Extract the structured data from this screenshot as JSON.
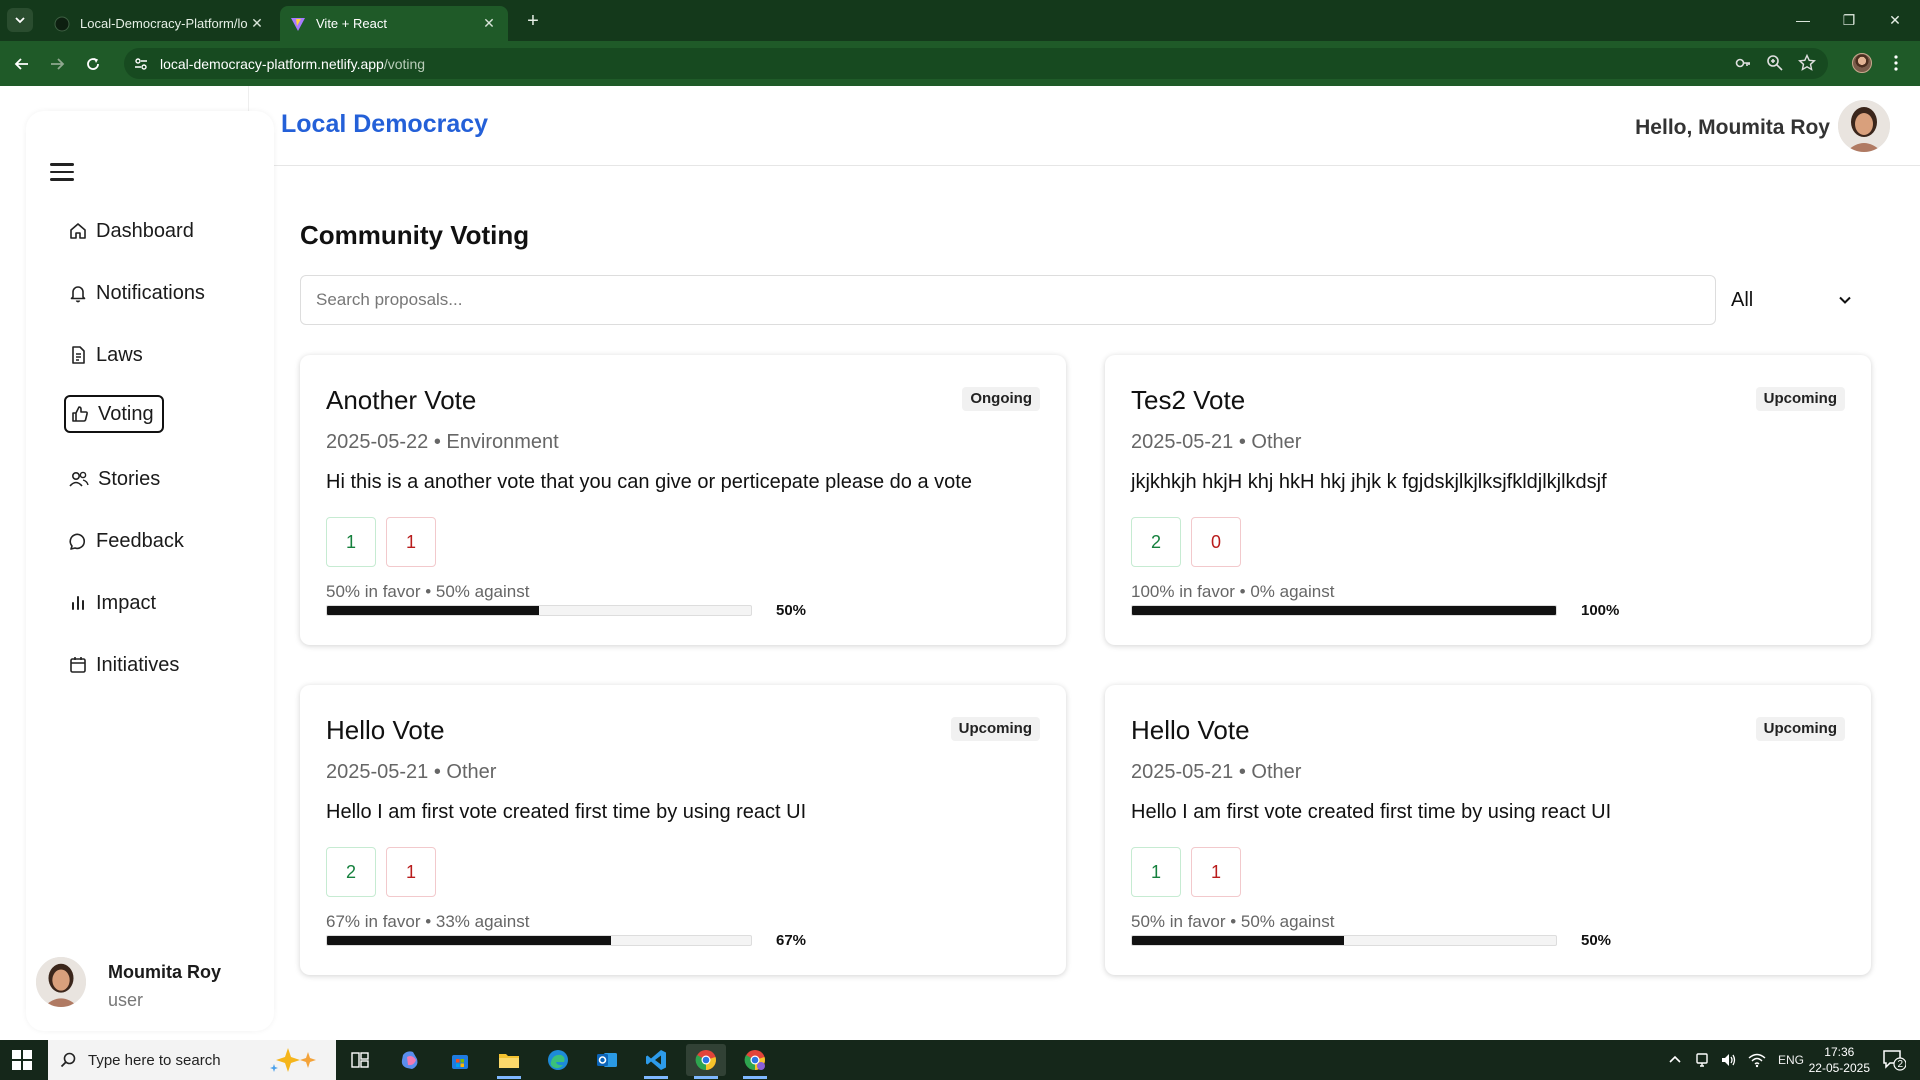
{
  "browser": {
    "tabs": [
      {
        "title": "Local-Democracy-Platform/loca",
        "active": false
      },
      {
        "title": "Vite + React",
        "active": true
      }
    ],
    "url_host": "local-democracy-platform.netlify.app",
    "url_path": "/voting"
  },
  "header": {
    "brand": "Local Democracy",
    "greeting": "Hello, Moumita Roy"
  },
  "sidebar": {
    "items": [
      {
        "label": "Dashboard",
        "icon": "home-icon"
      },
      {
        "label": "Notifications",
        "icon": "bell-icon"
      },
      {
        "label": "Laws",
        "icon": "document-icon"
      },
      {
        "label": "Voting",
        "icon": "thumbs-up-icon",
        "active": true
      },
      {
        "label": "Stories",
        "icon": "users-icon"
      },
      {
        "label": "Feedback",
        "icon": "chat-bubble-icon"
      },
      {
        "label": "Impact",
        "icon": "bar-chart-icon"
      },
      {
        "label": "Initiatives",
        "icon": "calendar-icon"
      }
    ],
    "profile": {
      "name": "Moumita Roy",
      "role": "user"
    }
  },
  "main": {
    "title": "Community Voting",
    "search_placeholder": "Search proposals...",
    "filter_value": "All",
    "cards": [
      {
        "title": "Another Vote",
        "status": "Ongoing",
        "meta": "2025-05-22 • Environment",
        "description": "Hi this is a another vote that you can give or perticepate please do a vote",
        "yes": "1",
        "no": "1",
        "ratio_text": "50% in favor • 50% against",
        "percent_label": "50%",
        "percent": 50
      },
      {
        "title": "Tes2 Vote",
        "status": "Upcoming",
        "meta": "2025-05-21 • Other",
        "description": "jkjkhkjh hkjH khj hkH hkj jhjk k fgjdskjlkjlksjfkldjlkjlkdsjf",
        "yes": "2",
        "no": "0",
        "ratio_text": "100% in favor • 0% against",
        "percent_label": "100%",
        "percent": 100
      },
      {
        "title": "Hello Vote",
        "status": "Upcoming",
        "meta": "2025-05-21 • Other",
        "description": "Hello I am first vote created first time by using react UI",
        "yes": "2",
        "no": "1",
        "ratio_text": "67% in favor • 33% against",
        "percent_label": "67%",
        "percent": 67
      },
      {
        "title": "Hello Vote",
        "status": "Upcoming",
        "meta": "2025-05-21 • Other",
        "description": "Hello I am first vote created first time by using react UI",
        "yes": "1",
        "no": "1",
        "ratio_text": "50% in favor • 50% against",
        "percent_label": "50%",
        "percent": 50
      }
    ]
  },
  "taskbar": {
    "search_placeholder": "Type here to search",
    "language": "ENG",
    "time": "17:36",
    "date": "22-05-2025",
    "notification_count": "2"
  },
  "colors": {
    "brand": "#2460d8",
    "browser_frame": "#14391b",
    "browser_toolbar": "#1f5a28",
    "vote_yes": "#15803d",
    "vote_no": "#b91c1c",
    "progress_fill": "#111111"
  }
}
